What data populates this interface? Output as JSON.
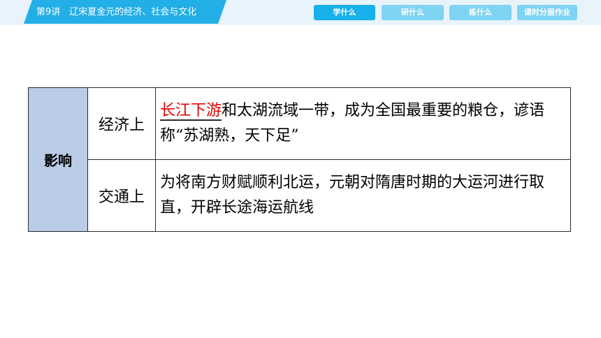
{
  "header": {
    "lesson_title": "第9讲　辽宋夏金元的经济、社会与文化",
    "tabs": [
      {
        "label": "学什么",
        "active": true
      },
      {
        "label": "研什么",
        "active": false
      },
      {
        "label": "练什么",
        "active": false
      },
      {
        "label": "课时分层作业",
        "active": false
      }
    ]
  },
  "table": {
    "heading": "影响",
    "rows": [
      {
        "category": "经济上",
        "highlight": "长江下游",
        "text": "和太湖流域一带，成为全国最重要的粮仓，谚语称“苏湖熟，天下足”"
      },
      {
        "category": "交通上",
        "highlight": "",
        "text": "为将南方财赋顺利北运，元朝对隋唐时期的大运河进行取直，开辟长途海运航线"
      }
    ]
  },
  "colors": {
    "title_tab": "#22aee6",
    "active_tab": "#18b0ea",
    "inactive_tab": "#7fd3f3",
    "heading_cell": "#b9cbe6",
    "highlight_text": "#e30000"
  }
}
